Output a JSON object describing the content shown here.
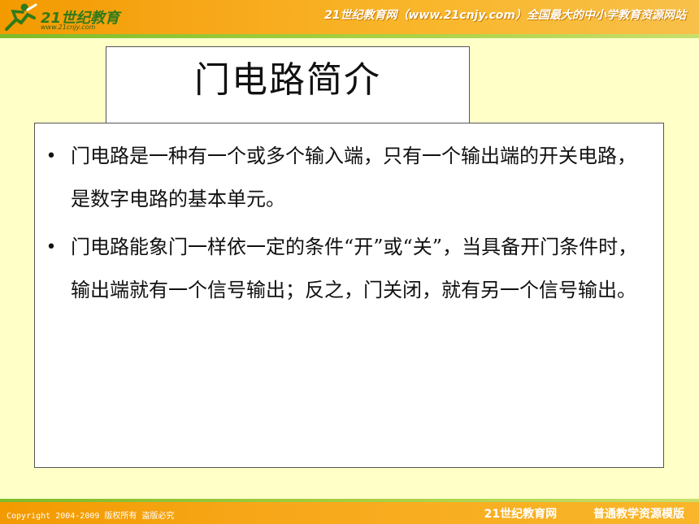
{
  "header": {
    "logo_text": "21世纪教育",
    "logo_url": "www.21cnjy.com",
    "slogan": "21世纪教育网（www.21cnjy.com）全国最大的中小学教育资源网站",
    "colors": {
      "band": "#f39a00",
      "stripe": "#7dbb2a"
    }
  },
  "slide": {
    "title": "门电路简介",
    "bullets": [
      "门电路是一种有一个或多个输入端，只有一个输出端的开关电路，是数字电路的基本单元。",
      "门电路能象门一样依一定的条件“开”或“关”，当具备开门条件时，输出端就有一个信号输出；反之，门关闭，就有另一个信号输出。"
    ]
  },
  "footer": {
    "copyright": "Copyright 2004-2009 版权所有 盗版必究",
    "site_name": "21世纪教育网",
    "template_name": "普通教学资源模版"
  }
}
